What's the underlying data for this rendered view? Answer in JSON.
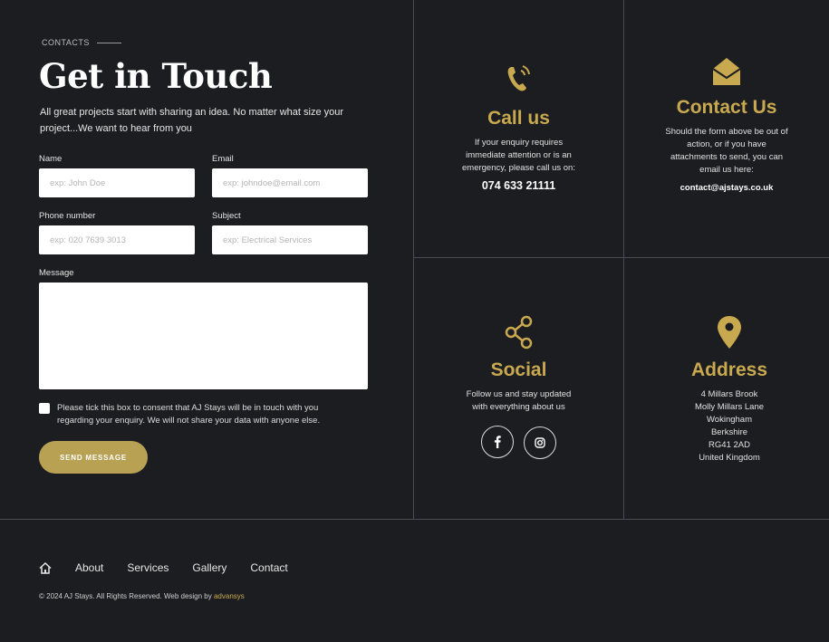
{
  "contact_section": {
    "eyebrow": "CONTACTS",
    "title": "Get in Touch",
    "intro": "All great projects start with sharing an idea. No matter what size your project...We want to hear from you"
  },
  "form": {
    "name_label": "Name",
    "name_placeholder": "exp: John Doe",
    "email_label": "Email",
    "email_placeholder": "exp: johndoe@email.com",
    "phone_label": "Phone number",
    "phone_placeholder": "exp: 020 7639 3013",
    "subject_label": "Subject",
    "subject_placeholder": "exp: Electrical Services",
    "message_label": "Message",
    "consent_text": "Please tick this box to consent that AJ Stays will be in touch with you regarding your enquiry. We will not share your data with anyone else.",
    "send_label": "SEND MESSAGE"
  },
  "call_card": {
    "heading": "Call us",
    "description": "If your enquiry requires immediate attention or is an emergency, please call us on:",
    "phone": "074 633 21111",
    "icon": "phone-ringing-icon"
  },
  "contact_card": {
    "heading": "Contact Us",
    "description": "Should the form above be out of action, or if you have attachments to send, you can email us here:",
    "email": "contact@ajstays.co.uk",
    "icon": "envelope-open-icon"
  },
  "social_card": {
    "heading": "Social",
    "description": "Follow us and stay updated with everything about us",
    "icon": "share-icon",
    "links": [
      "facebook-icon",
      "instagram-icon"
    ]
  },
  "address_card": {
    "heading": "Address",
    "lines": [
      "4 Millars Brook",
      "Molly Millars Lane",
      "Wokingham",
      "Berkshire",
      "RG41 2AD",
      "United Kingdom"
    ],
    "icon": "location-pin-icon"
  },
  "footer": {
    "nav": [
      "About",
      "Services",
      "Gallery",
      "Contact"
    ],
    "copyright": "© 2024 AJ Stays. All Rights Reserved. Web design by ",
    "designer": "advansys"
  },
  "colors": {
    "background": "#1c1d21",
    "accent": "#c9a94f",
    "button": "#b9a154",
    "divider": "#4a4b50"
  }
}
